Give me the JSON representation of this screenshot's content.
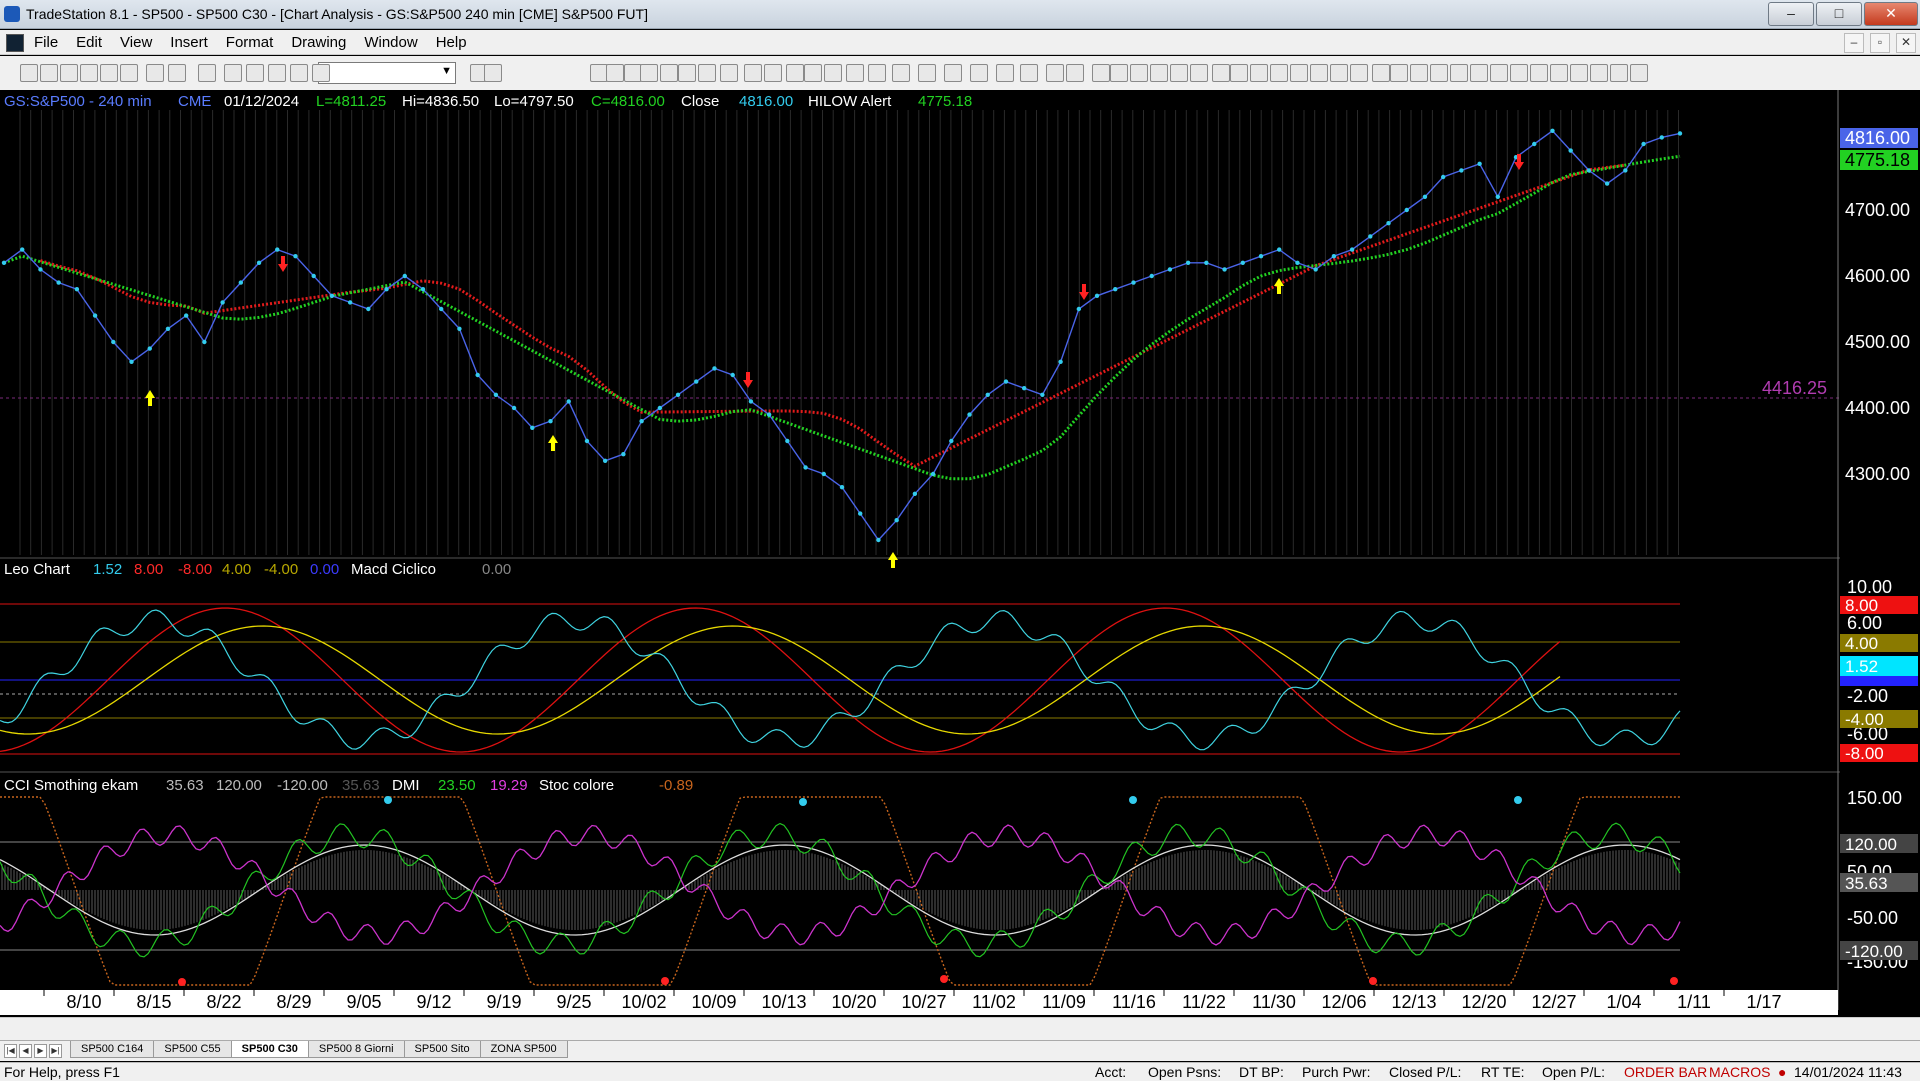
{
  "window": {
    "title": "TradeStation 8.1 - SP500 - SP500 C30 - [Chart Analysis - GS:S&P500  240 min  [CME] S&P500 FUT]",
    "min_label": "‒",
    "max_label": "□",
    "close_label": "✕"
  },
  "menu": {
    "items": [
      "File",
      "Edit",
      "View",
      "Insert",
      "Format",
      "Drawing",
      "Window",
      "Help"
    ],
    "mdi_min": "‒",
    "mdi_restore": "▫",
    "mdi_close": "✕"
  },
  "chart_header": {
    "symbol": "GS:S&P500 - 240 min",
    "exchange": "CME",
    "date": "01/12/2024",
    "last": "L=4811.25",
    "high": "Hi=4836.50",
    "low": "Lo=4797.50",
    "close_eq": "C=4816.00",
    "close_label": "Close",
    "close_val": "4816.00",
    "indicator": "HILOW Alert",
    "indicator_val": "4775.18"
  },
  "price_axis": {
    "ticks": [
      "4700.00",
      "4600.00",
      "4500.00",
      "4400.00",
      "4300.00"
    ],
    "last_price": "4816.00",
    "hilow_price": "4775.18",
    "line_label": "4416.25"
  },
  "panel2_header": {
    "name": "Leo Chart",
    "v1": "1.52",
    "v2": "8.00",
    "v3": "-8.00",
    "v4": "4.00",
    "v5": "-4.00",
    "v6": "0.00",
    "name2": "Macd Ciclico",
    "v7": "0.00"
  },
  "panel2_axis": {
    "ticks": [
      "10.00",
      "6.00",
      "2.00",
      "-2.00",
      "-6.00"
    ],
    "tags": [
      "8.00",
      "4.00",
      "1.52",
      "-4.00",
      "-8.00"
    ]
  },
  "panel3_header": {
    "name": "CCI Smothing ekam",
    "v1": "35.63",
    "v2": "120.00",
    "v3": "-120.00",
    "v4": "35.63",
    "dmi": "DMI",
    "dmi1": "23.50",
    "dmi2": "19.29",
    "stoc": "Stoc colore",
    "stoc_v": "-0.89"
  },
  "panel3_axis": {
    "ticks": [
      "150.00",
      "50.00",
      "-50.00",
      "-150.00"
    ],
    "tags": [
      "120.00",
      "35.63",
      "-120.00"
    ]
  },
  "x_axis": {
    "labels": [
      "8/10",
      "8/15",
      "8/22",
      "8/29",
      "9/05",
      "9/12",
      "9/19",
      "9/25",
      "10/02",
      "10/09",
      "10/13",
      "10/20",
      "10/27",
      "11/02",
      "11/09",
      "11/16",
      "11/22",
      "11/30",
      "12/06",
      "12/13",
      "12/20",
      "12/27",
      "1/04",
      "1/11",
      "1/17"
    ]
  },
  "sheet_tabs": [
    "SP500 C164",
    "SP500 C55",
    "SP500 C30",
    "SP500 8 Giorni",
    "SP500 Sito",
    "ZONA SP500"
  ],
  "status": {
    "help": "For Help, press F1",
    "acct": "Acct:",
    "open_psns": "Open Psns:",
    "dt_bp": "DT BP:",
    "purch_pwr": "Purch Pwr:",
    "closed_pl": "Closed P/L:",
    "rt_te": "RT TE:",
    "open_pl": "Open P/L:",
    "order_bar": "ORDER BAR",
    "macros": "MACROS",
    "datetime": "14/01/2024 11:43"
  },
  "chart_data": {
    "type": "line",
    "price_series_approx": [
      4620,
      4640,
      4610,
      4590,
      4580,
      4540,
      4500,
      4470,
      4490,
      4520,
      4540,
      4500,
      4560,
      4590,
      4620,
      4640,
      4630,
      4600,
      4570,
      4560,
      4550,
      4580,
      4600,
      4580,
      4550,
      4520,
      4450,
      4420,
      4400,
      4370,
      4380,
      4410,
      4350,
      4320,
      4330,
      4380,
      4400,
      4420,
      4440,
      4460,
      4450,
      4410,
      4390,
      4350,
      4310,
      4300,
      4280,
      4240,
      4200,
      4230,
      4270,
      4300,
      4350,
      4390,
      4420,
      4440,
      4430,
      4420,
      4470,
      4550,
      4570,
      4580,
      4590,
      4600,
      4610,
      4620,
      4620,
      4610,
      4620,
      4630,
      4640,
      4620,
      4610,
      4630,
      4640,
      4660,
      4680,
      4700,
      4720,
      4750,
      4760,
      4770,
      4720,
      4780,
      4800,
      4820,
      4790,
      4760,
      4740,
      4760,
      4800,
      4810,
      4816
    ]
  }
}
